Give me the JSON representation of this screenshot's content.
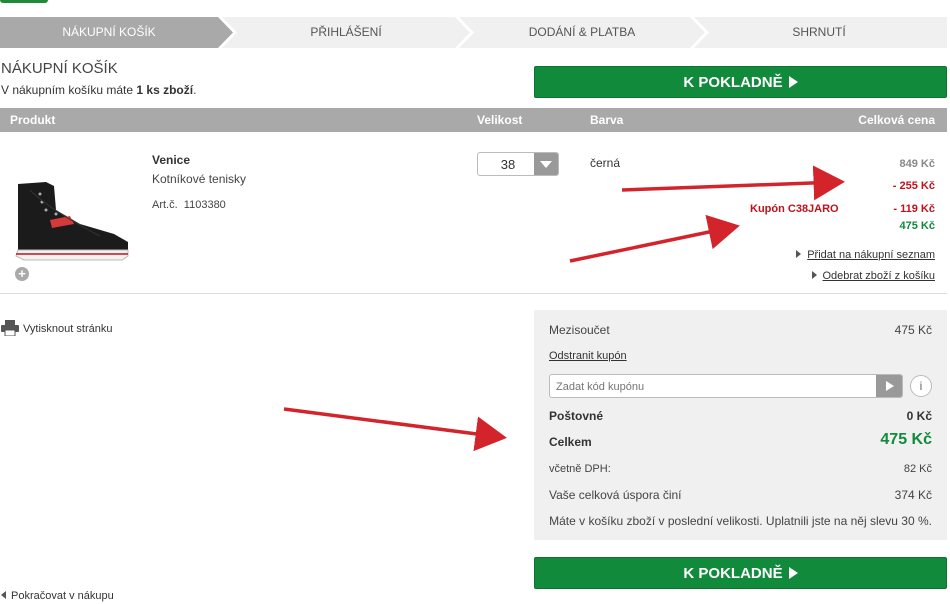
{
  "steps": [
    {
      "label": "Nákupní košík",
      "active": true
    },
    {
      "label": "Přihlášení",
      "active": false
    },
    {
      "label": "Dodání & platba",
      "active": false
    },
    {
      "label": "Shrnutí",
      "active": false
    }
  ],
  "cart": {
    "title": "NÁKUPNÍ KOŠÍK",
    "subtitle_prefix": "V nákupním košíku máte ",
    "subtitle_count": "1 ks zboží",
    "subtitle_suffix": ".",
    "checkout_label": "K POKLADNĚ"
  },
  "table_header": {
    "product": "Produkt",
    "size": "Velikost",
    "color": "Barva",
    "total": "Celková cena"
  },
  "item": {
    "name": "Venice",
    "description": "Kotníkové tenisky",
    "article_label": "Art.č.",
    "article_number": "1103380",
    "size": "38",
    "color": "černá",
    "price_original": "849 Kč",
    "discount": "- 255 Kč",
    "coupon_label": "Kupón C38JARO",
    "coupon_discount": "- 119 Kč",
    "price_final": "475 Kč",
    "add_to_wishlist": "Přidat na nákupní seznam",
    "remove_item": "Odebrat zboží z košíku"
  },
  "print_label": "Vytisknout stránku",
  "summary": {
    "subtotal_label": "Mezisoučet",
    "subtotal_value": "475 Kč",
    "remove_coupon": "Odstranit kupón",
    "coupon_placeholder": "Zadat kód kupónu",
    "info_glyph": "i",
    "shipping_label": "Poštovné",
    "shipping_value": "0 Kč",
    "total_label": "Celkem",
    "total_value": "475 Kč",
    "vat_label": "včetně DPH:",
    "vat_value": "82 Kč",
    "savings_label": "Vaše celková úspora činí",
    "savings_value": "374 Kč",
    "note": "Máte v košíku zboží v poslední velikosti. Uplatnili jste na něj slevu 30 %."
  },
  "continue_label": "Pokračovat v nákupu",
  "colors": {
    "green": "#118a3c",
    "red": "#c0121c",
    "arrow": "#d3242b",
    "header_gray": "#a9a9a9"
  }
}
